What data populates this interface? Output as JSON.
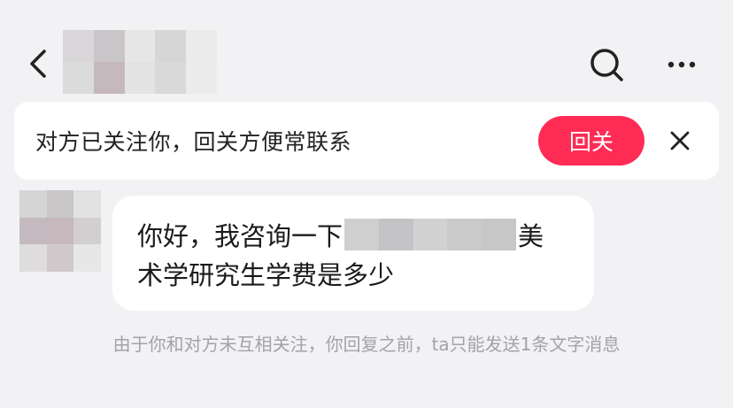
{
  "header": {
    "back_icon": "chevron-left-icon",
    "title_blur_colors": [
      "#d8d6d8",
      "#cac5c8",
      "#e6e6e7",
      "#d6d6d7",
      "#ebebeb",
      "#dcdbdc",
      "#c5b9be",
      "#e4e3e4",
      "#d9d9da",
      "#ececec"
    ],
    "search_icon": "search-icon",
    "more_icon": "more-horizontal-icon"
  },
  "follow_banner": {
    "text": "对方已关注你，回关方便常联系",
    "button_label": "回关",
    "button_color": "#fe2c55",
    "close_icon": "close-icon"
  },
  "message": {
    "avatar_blur_colors": [
      "#d6d5d6",
      "#c9c6c8",
      "#e2e1e2",
      "#c4b9be",
      "#c6b8bd",
      "#d2cfd1",
      "#dedcdd",
      "#cfc9cc",
      "#e7e7e7"
    ],
    "line1_before": "你好，我咨询一下",
    "redact_colors": [
      "#cfcfd0",
      "#c4c4c6",
      "#d2d2d3",
      "#cacacb",
      "#c7c7c8"
    ],
    "line1_after": "美",
    "line2": "术学研究生学费是多少"
  },
  "notice": {
    "text": "由于你和对方未互相关注，你回复之前，ta只能发送1条文字消息"
  }
}
